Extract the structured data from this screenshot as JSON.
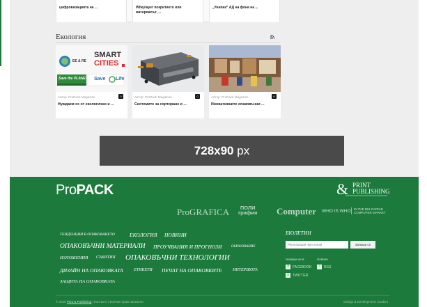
{
  "top_cards": [
    {
      "lines": [
        "цифровизацията на ..."
      ]
    },
    {
      "lines": [
        "Wheylayer покритието или",
        "материалът, ..."
      ]
    },
    {
      "lines": [
        "„Унипак“ АД на фона на ..."
      ]
    }
  ],
  "section": {
    "title": "Екология",
    "rss_icon": "rss-icon",
    "cards": [
      {
        "image_text": {
          "ee": "EE & RE",
          "smart": "SMART",
          "cities": "CITIES",
          "planet": "Save the PLANET",
          "life": "Save",
          "life2": "Life"
        },
        "author": "Автор: ProPack Magazine",
        "count": "0",
        "headline": "Нуждаем се от екологични и ..."
      },
      {
        "author": "Автор: ProPack Magazine",
        "count": "0",
        "headline": "Системите за сортиране и ..."
      },
      {
        "author": "Автор: ProPack Magazine",
        "count": "0",
        "headline": "Иновативните опаковъчни ..."
      }
    ]
  },
  "ad": {
    "size": "728x90",
    "unit": "px"
  },
  "footer": {
    "brand_light": "Pro",
    "brand_bold": "PACK",
    "print_logo": {
      "line1": "PRINT",
      "line2": "PUBLISHING"
    },
    "partners": {
      "prografica": "ProGRAFICA",
      "polygrafia_1": "ПОЛИ",
      "polygrafia_2": "графия",
      "computer": "Computer",
      "who_is_who": "WHO IS WHO",
      "bulgarian": "IN THE BULGARIAN",
      "bulgarian_2": "COMPUTER MARKET"
    },
    "nav": [
      "ТЕНДЕНЦИИ В ОПАКОВАНЕТО",
      "ЕКОЛОГИЯ",
      "НОВИНИ",
      "ОПАКОВЪЧНИ МАТЕРИАЛИ",
      "ПРОУЧВАНИЯ И ПРОГНОЗИ",
      "ОБРАЗОВАНИЕ",
      "ИЗЛОЖЕНИЯ",
      "СЪБИТИЯ",
      "ОПАКОВЪЧНИ ТЕХНОЛОГИИ",
      "ДИЗАЙН НА ОПАКОВКАТА",
      "ЕТИКЕТИ",
      "ПЕЧАТ НА ОПАКОВКИТЕ",
      "ИНТЕРВЮТА",
      "ЗАЩИТА НА ОПАКОВКАТА"
    ],
    "newsletter": {
      "title": "БЮЛЕТИН",
      "placeholder": "Регистрация чрез email",
      "button": "Запиши се"
    },
    "social": {
      "find_us": "Намери ни в:",
      "news": "Новини",
      "facebook": "FACEBOOK",
      "rss": "RSS",
      "twitter": "TWITTER"
    },
    "copyright_prefix": "© 2015",
    "copyright_link": "Print & Publishing",
    "copyright_rest": "| Контакти | Всички права запазени",
    "design": "Design & Development: Studio4"
  },
  "colors": {
    "footer_green": "#1d7a3d",
    "ad_gray": "#4a4a4a",
    "page_bg": "#eeeeee"
  }
}
